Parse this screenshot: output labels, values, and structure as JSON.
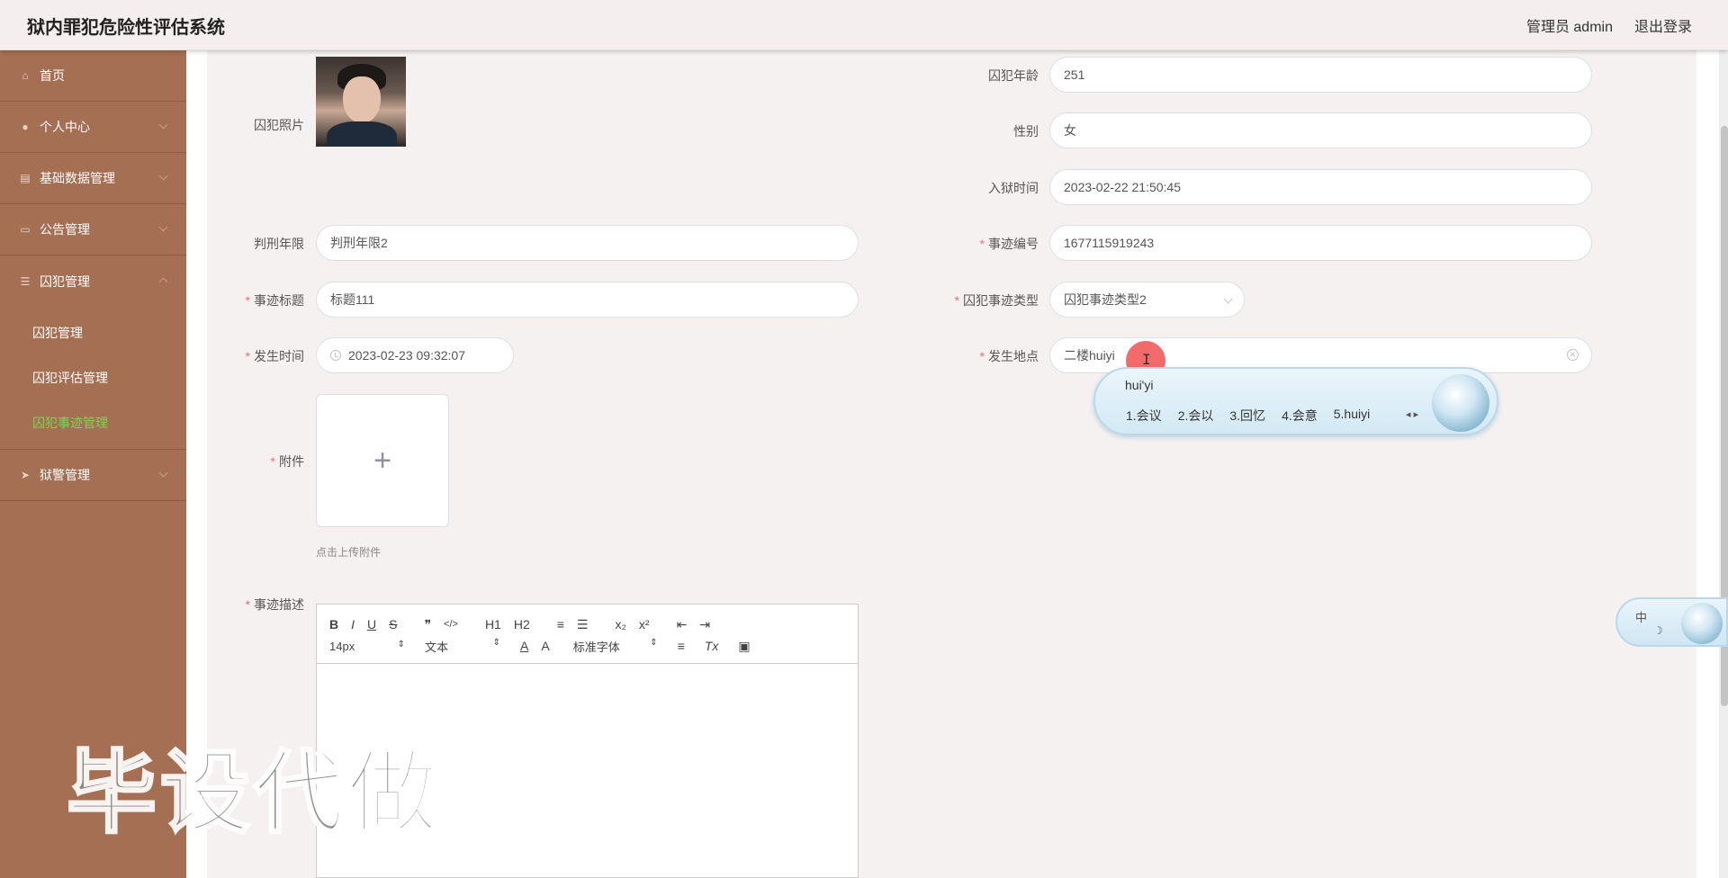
{
  "header": {
    "title": "狱内罪犯危险性评估系统",
    "admin_label": "管理员 admin",
    "logout_label": "退出登录"
  },
  "sidebar": {
    "items": [
      {
        "label": "首页",
        "icon": "home-icon"
      },
      {
        "label": "个人中心",
        "icon": "user-icon"
      },
      {
        "label": "基础数据管理",
        "icon": "database-icon"
      },
      {
        "label": "公告管理",
        "icon": "monitor-icon"
      },
      {
        "label": "囚犯管理",
        "icon": "list-icon"
      },
      {
        "label": "狱警管理",
        "icon": "send-icon"
      }
    ],
    "sub_items": [
      {
        "label": "囚犯管理"
      },
      {
        "label": "囚犯评估管理"
      },
      {
        "label": "囚犯事迹管理"
      }
    ]
  },
  "form": {
    "photo_label": "囚犯照片",
    "age_label": "囚犯年龄",
    "age_value": "251",
    "gender_label": "性别",
    "gender_value": "女",
    "entry_time_label": "入狱时间",
    "entry_time_value": "2023-02-22 21:50:45",
    "sentence_label": "判刑年限",
    "sentence_value": "判刑年限2",
    "deed_no_label": "事迹编号",
    "deed_no_value": "1677115919243",
    "deed_title_label": "事迹标题",
    "deed_title_value": "标题111",
    "deed_type_label": "囚犯事迹类型",
    "deed_type_value": "囚犯事迹类型2",
    "occur_time_label": "发生时间",
    "occur_time_value": "2023-02-23 09:32:07",
    "location_label": "发生地点",
    "location_value": "二楼huiyi",
    "attachment_label": "附件",
    "attachment_hint": "点击上传附件",
    "description_label": "事迹描述",
    "required_mark": "*",
    "plus_glyph": "+"
  },
  "editor": {
    "bold": "B",
    "italic": "I",
    "underline": "U",
    "strike": "S",
    "quote": "❞",
    "code": "</>",
    "h1": "H1",
    "h2": "H2",
    "ordered_list": "≡",
    "bullet_list": "☰",
    "sub": "x₂",
    "sup": "x²",
    "outdent": "⇤",
    "indent": "⇥",
    "font_size": "14px",
    "text_type": "文本",
    "font_family": "标准字体",
    "font_color": "A",
    "bg_color": "A",
    "align": "≡",
    "clear_format": "Tx",
    "image": "▣"
  },
  "ime": {
    "composition": "hui'yi",
    "candidates": [
      "1.会议",
      "2.会以",
      "3.回忆",
      "4.会意",
      "5.huiyi"
    ],
    "nav": "◂ ▸",
    "mini_label": "中",
    "mini_symbol": "☽"
  },
  "watermark": "毕设代做",
  "cursor_glyph": "I"
}
